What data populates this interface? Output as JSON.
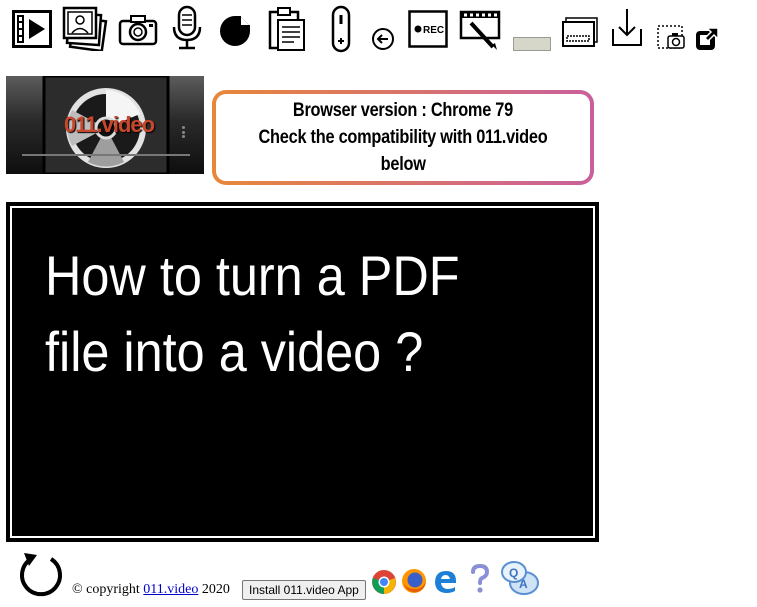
{
  "toolbar": {
    "icons": [
      "video-player-icon",
      "photo-album-icon",
      "camera-icon",
      "microphone-icon",
      "sticker-icon",
      "clipboard-icon",
      "slider-icon",
      "back-arrow-icon",
      "record-icon",
      "video-edit-icon",
      "color-swatch-icon",
      "window-minimize-icon",
      "download-icon",
      "screenshot-icon",
      "external-link-icon"
    ],
    "record_label": "REC",
    "swatch_color": "#d6d7c8"
  },
  "thumbnail": {
    "logo_text": "011.video"
  },
  "info_box": {
    "line1": "Browser version : Chrome 79",
    "line2": "Check the compatibility with 011.video",
    "line3": "below"
  },
  "stage": {
    "title_line1": "How to turn a PDF",
    "title_line2": "file into a video ?"
  },
  "footer": {
    "copyright_prefix": "© copyright ",
    "copyright_link": "011.video",
    "copyright_year": " 2020",
    "install_button": "Install 011.video App",
    "browser_icons": [
      "chrome-icon",
      "firefox-icon",
      "edge-icon",
      "help-question-icon",
      "qa-chat-icon"
    ]
  },
  "colors": {
    "info_border_start": "#e8873a",
    "info_border_end": "#c9609c",
    "stage_background": "#000000",
    "link": "#0000cc"
  }
}
